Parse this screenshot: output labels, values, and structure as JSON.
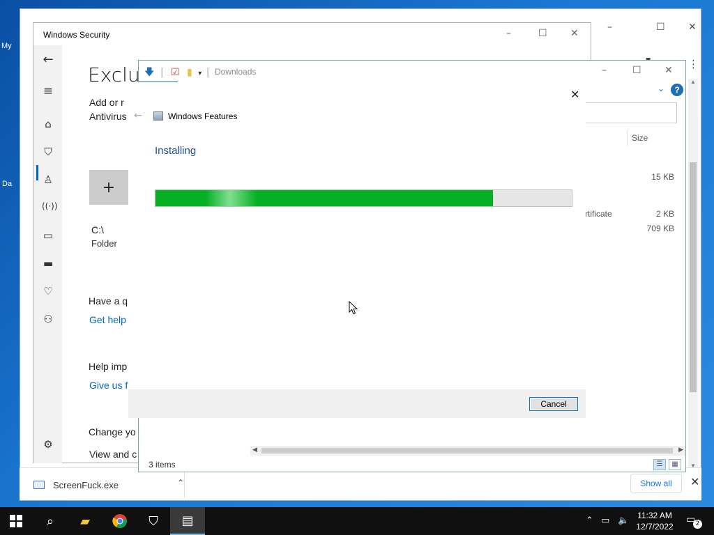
{
  "desktop": {
    "label_my": "My",
    "label_da": "Da"
  },
  "chrome": {
    "downloads_bar": {
      "file_name": "ScreenFuck.exe",
      "show_all": "Show all"
    }
  },
  "windows_security": {
    "title": "Windows Security",
    "heading": "Exclus",
    "add_text_1": "Add or r",
    "add_text_2": "Antivirus",
    "add_button": "+",
    "item_path": "C:\\",
    "item_type": "Folder",
    "question": "Have a q",
    "get_help": "Get help",
    "help_improve": "Help imp",
    "give_feedback": "Give us fe",
    "change_your": "Change yo",
    "view_and": "View and c"
  },
  "explorer": {
    "title": "Downloads",
    "column_size": "Size",
    "rows": [
      {
        "type": "",
        "size": "15 KB"
      },
      {
        "type": "rtificate",
        "size": "2 KB"
      },
      {
        "type": "",
        "size": "709 KB"
      }
    ],
    "item_count": "3 items"
  },
  "windows_features": {
    "title": "Windows Features",
    "status": "Installing",
    "progress_percent": 81,
    "cancel": "Cancel"
  },
  "taskbar": {
    "time": "11:32 AM",
    "date": "12/7/2022",
    "notification_count": "2"
  }
}
